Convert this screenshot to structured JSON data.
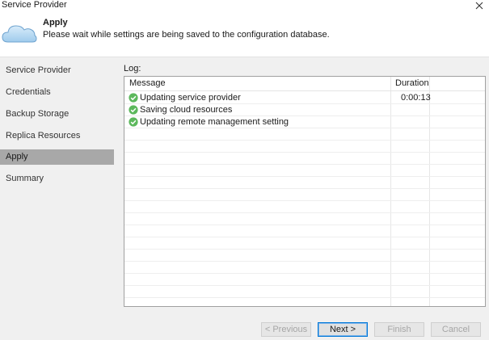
{
  "window": {
    "title": "Service Provider"
  },
  "header": {
    "title": "Apply",
    "description": "Please wait while settings are being saved to the configuration database."
  },
  "sidebar": {
    "items": [
      {
        "label": "Service Provider",
        "active": false
      },
      {
        "label": "Credentials",
        "active": false
      },
      {
        "label": "Backup Storage",
        "active": false
      },
      {
        "label": "Replica Resources",
        "active": false
      },
      {
        "label": "Apply",
        "active": true
      },
      {
        "label": "Summary",
        "active": false
      }
    ]
  },
  "log": {
    "label": "Log:",
    "columns": {
      "message": "Message",
      "duration": "Duration"
    },
    "rows": [
      {
        "status": "success",
        "message": "Updating service provider",
        "duration": "0:00:13"
      },
      {
        "status": "success",
        "message": "Saving cloud resources",
        "duration": ""
      },
      {
        "status": "success",
        "message": "Updating remote management setting",
        "duration": ""
      }
    ]
  },
  "buttons": {
    "previous": "< Previous",
    "next": "Next >",
    "finish": "Finish",
    "cancel": "Cancel"
  },
  "colors": {
    "success": "#5cb85c",
    "active_nav": "#a8a8a8",
    "focus_border": "#0078d7"
  },
  "icons": {
    "header": "cloud-icon",
    "row_status": "check-circle-icon",
    "close": "close-icon"
  }
}
